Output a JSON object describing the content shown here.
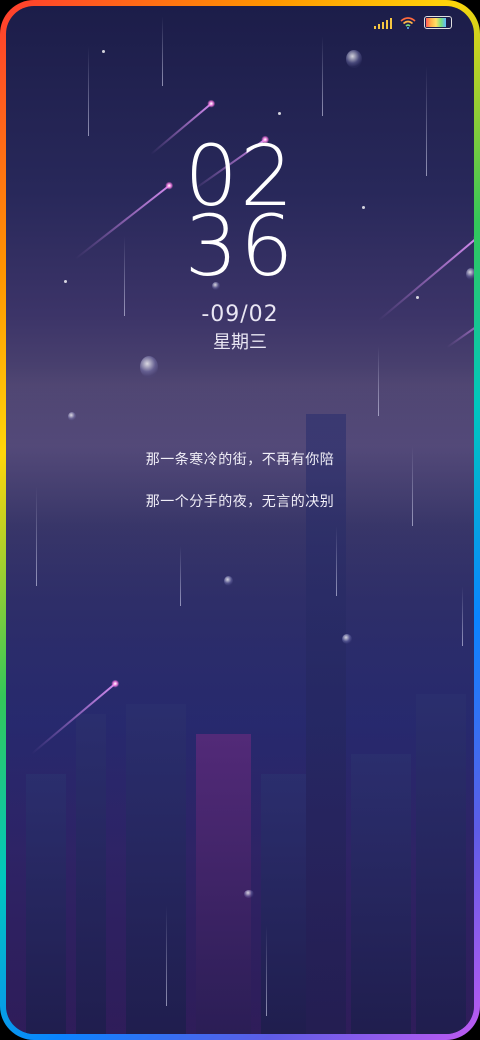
{
  "status_bar": {
    "signal_icon": "signal-bars-icon",
    "wifi_icon": "wifi-icon",
    "battery_icon": "battery-icon",
    "battery_level": 0.9
  },
  "clock": {
    "hour": "02",
    "minute": "36",
    "date": "-09/02",
    "weekday": "星期三"
  },
  "lyrics": {
    "line1": "那一条寒冷的街，不再有你陪",
    "line2": "那一个分手的夜，无言的决别"
  },
  "colors": {
    "frame_gradient": [
      "#ff3b30",
      "#ff9500",
      "#ffd60a",
      "#34c759",
      "#00c7be",
      "#0a84ff",
      "#5e5ce6",
      "#bf5af2"
    ],
    "sky_top": "#1c1d49",
    "text": "#ffffff"
  }
}
